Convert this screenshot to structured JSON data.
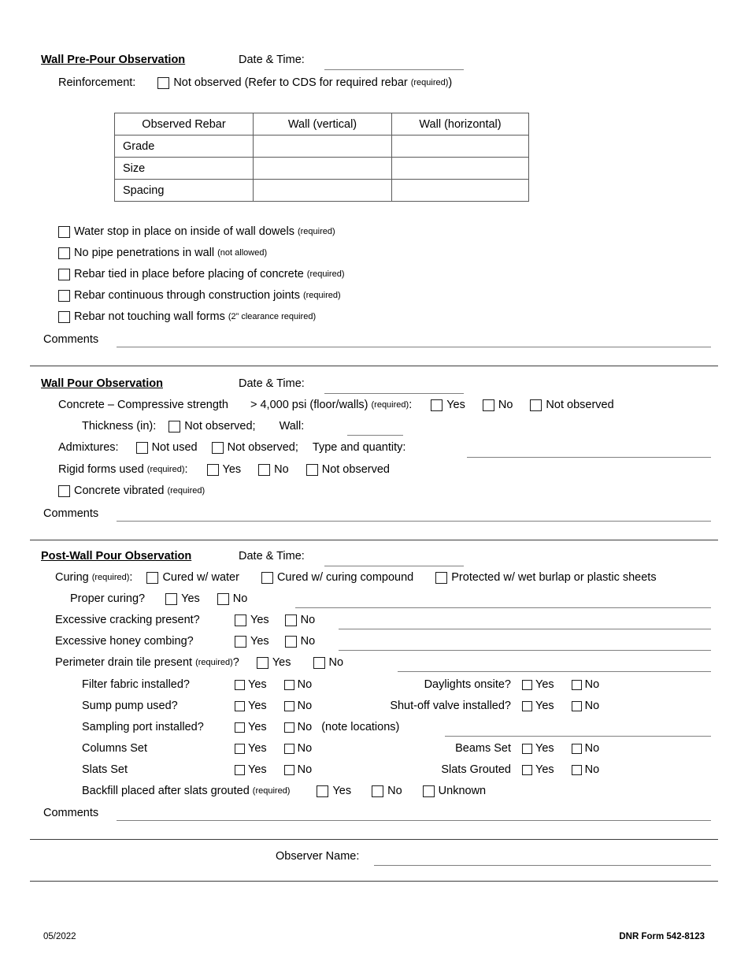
{
  "form": {
    "footer_date": "05/2022",
    "footer_form_no": "DNR Form 542-8123",
    "labels": {
      "date_time": "Date & Time:",
      "comments": "Comments",
      "observer_name": "Observer Name:",
      "yes": "Yes",
      "no": "No",
      "not_observed": "Not observed",
      "unknown": "Unknown",
      "required": "(required)",
      "not_allowed": "(not allowed)"
    }
  },
  "section_prepour": {
    "heading": "Wall Pre-Pour Observation",
    "reinforcement_label": "Reinforcement:",
    "reinforcement_option": "Not observed (Refer to CDS for required rebar",
    "reinforcement_option_note": "(required)",
    "reinforcement_option_tail": ")",
    "table": {
      "headers": [
        "Observed Rebar",
        "Wall (vertical)",
        "Wall (horizontal)"
      ],
      "rows": [
        {
          "label": "Grade",
          "vertical": "",
          "horizontal": ""
        },
        {
          "label": "Size",
          "vertical": "",
          "horizontal": ""
        },
        {
          "label": "Spacing",
          "vertical": "",
          "horizontal": ""
        }
      ]
    },
    "checklist": [
      {
        "text": "Water stop in place on inside of wall dowels",
        "note": "(required)"
      },
      {
        "text": "No pipe penetrations in wall",
        "note": "(not allowed)"
      },
      {
        "text": "Rebar tied in place before placing of concrete",
        "note": "(required)"
      },
      {
        "text": "Rebar continuous through construction joints",
        "note": "(required)"
      },
      {
        "text": "Rebar not touching wall forms",
        "note": "(2” clearance required)"
      }
    ],
    "comments_label": "Comments",
    "comments_value": ""
  },
  "section_pour": {
    "heading": "Wall Pour Observation",
    "concrete_label": "Concrete – Compressive strength",
    "concrete_spec": "> 4,000 psi (floor/walls)",
    "concrete_spec_note": "(required)",
    "concrete_spec_colon": ":",
    "concrete_options": [
      "Yes",
      "No",
      "Not observed"
    ],
    "thickness_label": "Thickness (in):",
    "thickness_not_observed": "Not observed;",
    "thickness_wall_label": "Wall:",
    "thickness_wall_value": "",
    "admixtures_label": "Admixtures:",
    "admixtures_not_used": "Not used",
    "admixtures_not_observed": "Not observed;",
    "admixtures_type_label": "Type and quantity:",
    "admixtures_type_value": "",
    "rigid_forms_label": "Rigid forms used",
    "rigid_forms_note": "(required)",
    "rigid_forms_colon": ":",
    "rigid_forms_options": [
      "Yes",
      "No",
      "Not observed"
    ],
    "vibrated_label": "Concrete vibrated",
    "vibrated_note": "(required)",
    "comments_label": "Comments",
    "comments_value": ""
  },
  "section_postpour": {
    "heading": "Post-Wall Pour Observation",
    "curing_label": "Curing",
    "curing_note": "(required)",
    "curing_colon": ":",
    "curing_options": [
      "Cured w/ water",
      "Cured w/ curing compound",
      "Protected w/ wet burlap or plastic sheets"
    ],
    "proper_curing_label": "Proper curing?",
    "proper_curing_value": "",
    "rows": [
      {
        "label": "Excessive cracking present?",
        "note": "",
        "value": ""
      },
      {
        "label": "Excessive honey combing?",
        "note": "",
        "value": ""
      }
    ],
    "drain_tile_label": "Perimeter drain tile present",
    "drain_tile_note": "(required)",
    "drain_tile_tail": "?",
    "drain_tile_value": "",
    "sub_rows": [
      {
        "left_label": "Filter fabric installed?",
        "right_label": "Daylights onsite?"
      },
      {
        "left_label": "Sump pump used?",
        "right_label": "Shut-off valve installed?"
      },
      {
        "left_label": "Columns Set",
        "right_label": "Beams Set"
      },
      {
        "left_label": "Slats Set",
        "right_label": "Slats Grouted"
      }
    ],
    "sampling_port_label": "Sampling port installed?",
    "sampling_port_note": "(note locations)",
    "sampling_port_value": "",
    "backfill_label": "Backfill placed after slats grouted",
    "backfill_note": "(required)",
    "backfill_options": [
      "Yes",
      "No",
      "Unknown"
    ],
    "comments_label": "Comments",
    "comments_value": ""
  }
}
